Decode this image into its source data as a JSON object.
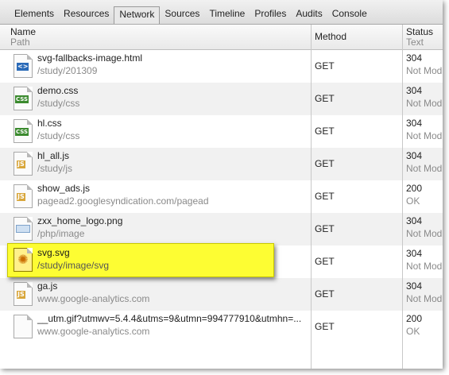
{
  "tabs": [
    {
      "label": "Elements",
      "active": false
    },
    {
      "label": "Resources",
      "active": false
    },
    {
      "label": "Network",
      "active": true
    },
    {
      "label": "Sources",
      "active": false
    },
    {
      "label": "Timeline",
      "active": false
    },
    {
      "label": "Profiles",
      "active": false
    },
    {
      "label": "Audits",
      "active": false
    },
    {
      "label": "Console",
      "active": false
    }
  ],
  "columns": {
    "name": {
      "title": "Name",
      "subtitle": "Path"
    },
    "method": {
      "title": "Method"
    },
    "status": {
      "title": "Status",
      "subtitle": "Text"
    }
  },
  "rows": [
    {
      "name": "svg-fallbacks-image.html",
      "path": "/study/201309",
      "method": "GET",
      "status_code": "304",
      "status_text": "Not Modified",
      "icon": "html-file-icon"
    },
    {
      "name": "demo.css",
      "path": "/study/css",
      "method": "GET",
      "status_code": "304",
      "status_text": "Not Modified",
      "icon": "css-file-icon"
    },
    {
      "name": "hl.css",
      "path": "/study/css",
      "method": "GET",
      "status_code": "304",
      "status_text": "Not Modified",
      "icon": "css-file-icon"
    },
    {
      "name": "hl_all.js",
      "path": "/study/js",
      "method": "GET",
      "status_code": "304",
      "status_text": "Not Modified",
      "icon": "js-file-icon"
    },
    {
      "name": "show_ads.js",
      "path": "pagead2.googlesyndication.com/pagead",
      "method": "GET",
      "status_code": "200",
      "status_text": "OK",
      "icon": "js-file-icon"
    },
    {
      "name": "zxx_home_logo.png",
      "path": "/php/image",
      "method": "GET",
      "status_code": "304",
      "status_text": "Not Modified",
      "icon": "image-file-icon"
    },
    {
      "name": "svg.svg",
      "path": "/study/image/svg",
      "method": "GET",
      "status_code": "304",
      "status_text": "Not Modified",
      "icon": "svg-file-icon",
      "highlighted": true
    },
    {
      "name": "ga.js",
      "path": "www.google-analytics.com",
      "method": "GET",
      "status_code": "304",
      "status_text": "Not Modified",
      "icon": "js-file-icon"
    },
    {
      "name": "__utm.gif?utmwv=5.4.4&utms=9&utmn=994777910&utmhn=...",
      "path": "www.google-analytics.com",
      "method": "GET",
      "status_code": "200",
      "status_text": "OK",
      "icon": "blank-file-icon"
    }
  ],
  "colors": {
    "highlight": "#fdfd33",
    "grid": "#c8c8c8",
    "stripe": "#f1f1f1"
  }
}
